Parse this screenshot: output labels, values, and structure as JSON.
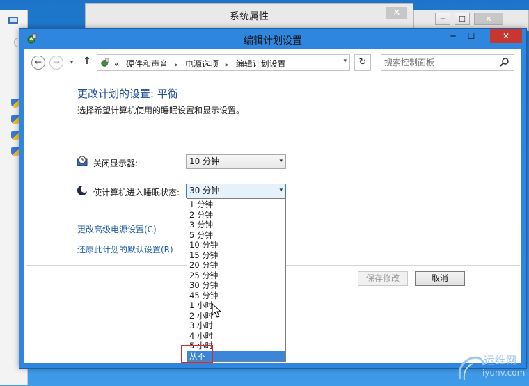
{
  "background_windows": {
    "system_properties_title": "系统属性",
    "close_glyph": "✕",
    "right_window_buttons": [
      "─",
      "☐",
      "✕"
    ]
  },
  "window": {
    "title": "编辑计划设置",
    "minimize": "─",
    "maximize": "☐",
    "close": "✕"
  },
  "nav": {
    "back": "←",
    "forward": "→",
    "recent": "▾",
    "up": "↑",
    "prefix": "«",
    "breadcrumbs": [
      "硬件和声音",
      "电源选项",
      "编辑计划设置"
    ],
    "separator": "▸",
    "address_dropdown": "▾",
    "refresh": "↻",
    "search_placeholder": "搜索控制面板"
  },
  "content": {
    "heading": "更改计划的设置: 平衡",
    "subheading": "选择希望计算机使用的睡眠设置和显示设置。",
    "display_label": "关闭显示器:",
    "display_value": "10 分钟",
    "sleep_label": "使计算机进入睡眠状态:",
    "sleep_value": "30 分钟",
    "dropdown_arrow": "▾",
    "advanced_link": "更改高级电源设置(C)",
    "restore_link": "还原此计划的默认设置(R)",
    "save_button": "保存修改",
    "cancel_button": "取消"
  },
  "dropdown_options": [
    "1 分钟",
    "2 分钟",
    "3 分钟",
    "5 分钟",
    "10 分钟",
    "15 分钟",
    "20 分钟",
    "25 分钟",
    "30 分钟",
    "45 分钟",
    "1 小时",
    "2 小时",
    "3 小时",
    "4 小时",
    "5 小时",
    "从不"
  ],
  "selected_option": "从不",
  "watermark": {
    "cn": "运维网",
    "en": "iyunv.com"
  },
  "colors": {
    "title_bar": "#2f86de",
    "close_button": "#c7372f",
    "link": "#1f5fa8",
    "heading": "#1f4e99",
    "selection": "#3b86d8",
    "highlight_box": "#e0262b"
  }
}
